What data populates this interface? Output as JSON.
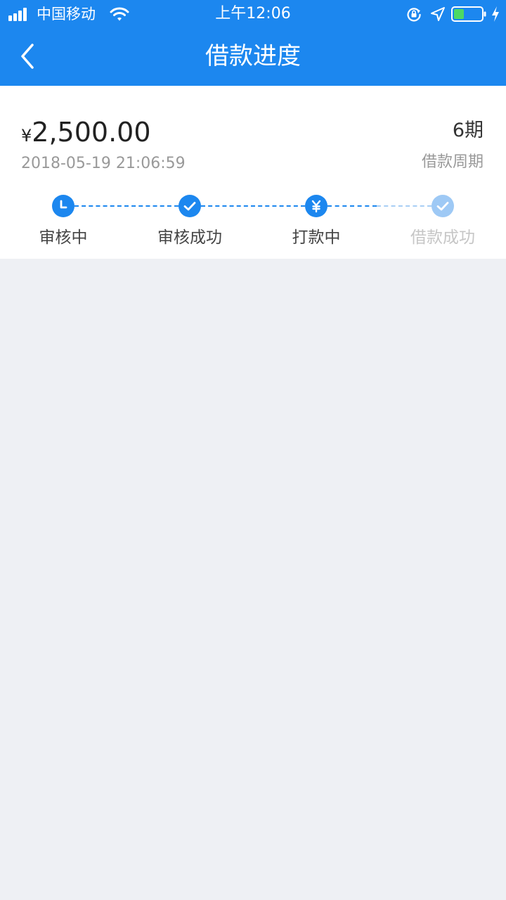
{
  "status_bar": {
    "carrier": "中国移动",
    "time": "上午12:06",
    "battery_color": "#4cd964"
  },
  "header": {
    "title": "借款进度",
    "back_icon": "chevron-left-icon",
    "background_color": "#1c87ef"
  },
  "loan": {
    "currency": "¥",
    "amount": "2,500.00",
    "datetime": "2018-05-19 21:06:59",
    "period_value": "6期",
    "period_label": "借款周期"
  },
  "progress": {
    "steps": [
      {
        "label": "审核中",
        "icon": "clock-icon",
        "state": "active"
      },
      {
        "label": "审核成功",
        "icon": "check-icon",
        "state": "done"
      },
      {
        "label": "打款中",
        "icon": "yen-icon",
        "state": "active"
      },
      {
        "label": "借款成功",
        "icon": "check-icon",
        "state": "pending"
      }
    ]
  }
}
